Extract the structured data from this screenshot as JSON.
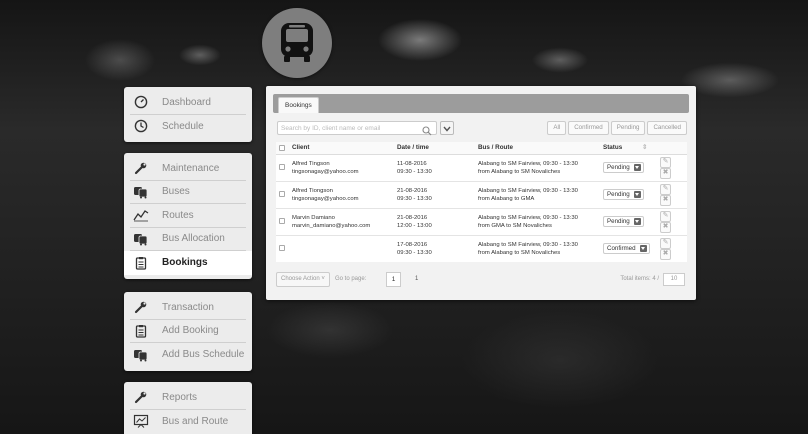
{
  "sidebar": {
    "group1": [
      {
        "label": "Dashboard",
        "icon": "dashboard-gauge-icon"
      },
      {
        "label": "Schedule",
        "icon": "clock-icon"
      }
    ],
    "group2": [
      {
        "label": "Maintenance",
        "icon": "wrench-icon"
      },
      {
        "label": "Buses",
        "icon": "buses-icon"
      },
      {
        "label": "Routes",
        "icon": "routes-chart-icon"
      },
      {
        "label": "Bus Allocation",
        "icon": "buses-icon"
      },
      {
        "label": "Bookings",
        "icon": "clipboard-icon",
        "active": true
      }
    ],
    "group3": [
      {
        "label": "Transaction",
        "icon": "wrench-icon"
      },
      {
        "label": "Add Booking",
        "icon": "clipboard-icon"
      },
      {
        "label": "Add Bus Schedule",
        "icon": "buses-icon"
      }
    ],
    "group4": [
      {
        "label": "Reports",
        "icon": "wrench-icon"
      },
      {
        "label": "Bus and Route",
        "icon": "presentation-icon"
      }
    ]
  },
  "panel": {
    "tab": "Bookings",
    "search_placeholder": "Search by ID, client name or email",
    "filters": [
      "All",
      "Confirmed",
      "Pending",
      "Cancelled"
    ],
    "columns": [
      "Client",
      "Date / time",
      "Bus / Route",
      "Status"
    ],
    "rows": [
      {
        "client": "Alfred Tingson",
        "email": "tingsonagay@yahoo.com",
        "date": "11-08-2016",
        "time": "09:30 - 13:30",
        "route": "Alabang to SM Fairview, 09:30 - 13:30",
        "route2": "from Alabang to SM Novaliches",
        "status": "Pending"
      },
      {
        "client": "Alfred Tiongson",
        "email": "tingsonagay@yahoo.com",
        "date": "21-08-2016",
        "time": "09:30 - 13:30",
        "route": "Alabang to SM Fairview, 09:30 - 13:30",
        "route2": "from Alabang to GMA",
        "status": "Pending"
      },
      {
        "client": "Marvin Damiano",
        "email": "marvin_damiano@yahoo.com",
        "date": "21-08-2016",
        "time": "12:00 - 13:00",
        "route": "Alabang to SM Fairview, 09:30 - 13:30",
        "route2": "from GMA to SM Novaliches",
        "status": "Pending"
      },
      {
        "client": "",
        "email": "",
        "date": "17-08-2016",
        "time": "09:30 - 13:30",
        "route": "Alabang to SM Fairview, 09:30 - 13:30",
        "route2": "from Alabang to SM Novaliches",
        "status": "Confirmed"
      }
    ],
    "footer": {
      "choose_action": "Choose Action",
      "goto_label": "Go to page:",
      "page": "1",
      "page_total": "1",
      "total_items": "Total items: 4 /",
      "per_page": "10"
    }
  }
}
